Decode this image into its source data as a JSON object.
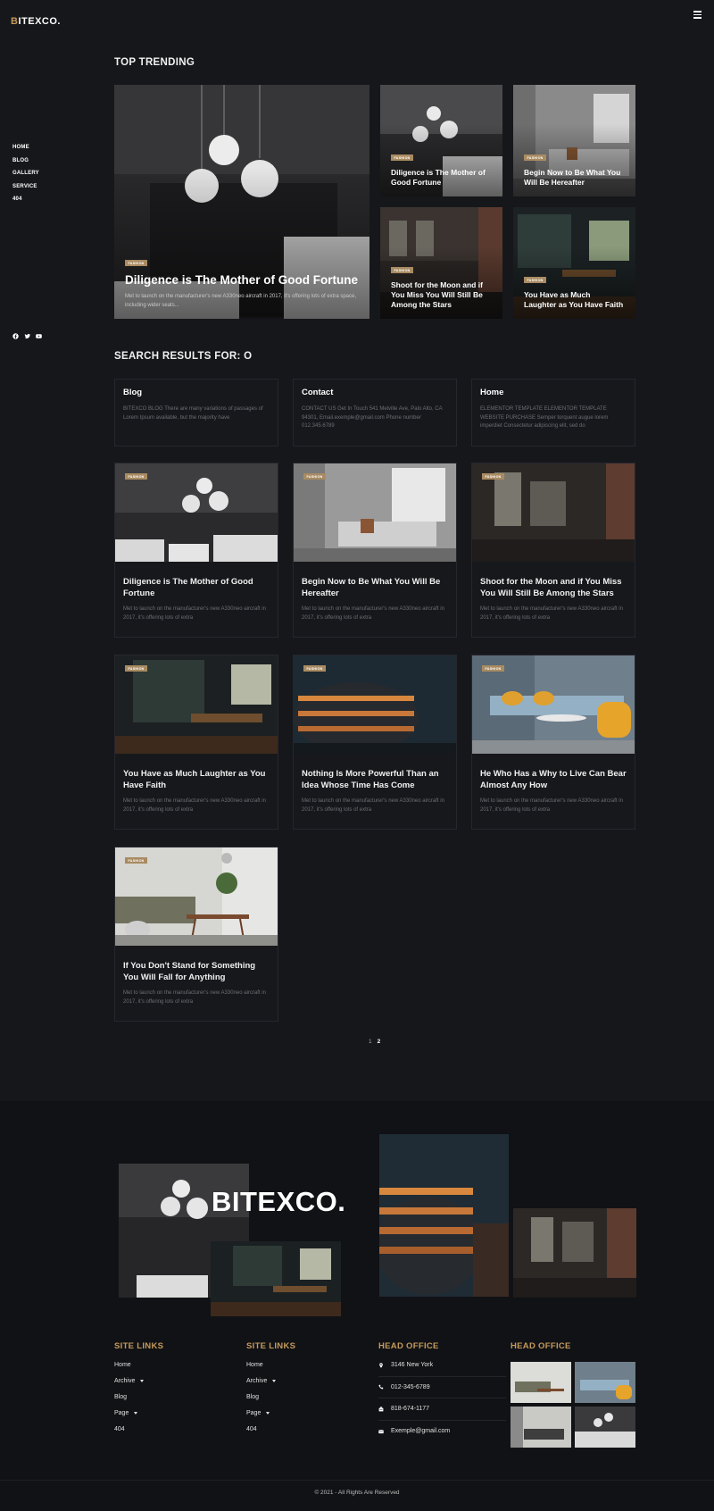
{
  "header": {
    "logo_first": "B",
    "logo_rest": "ITEXCO."
  },
  "nav": {
    "items": [
      "HOME",
      "BLOG",
      "GALLERY",
      "SERVICE",
      "404"
    ]
  },
  "social": [
    "facebook-icon",
    "twitter-icon",
    "youtube-icon"
  ],
  "trending": {
    "heading": "TOP TRENDING",
    "featured": {
      "badge": "FASHION",
      "title": "Diligence is The Mother of Good Fortune",
      "desc": "Met to launch on the manufacturer's new A330neo aircraft in 2017, it's offering lots of extra space, including wider seats..."
    },
    "cards": [
      {
        "badge": "FASHION",
        "title": "Diligence is The Mother of Good Fortune"
      },
      {
        "badge": "FASHION",
        "title": "Begin Now to Be What You Will Be Hereafter"
      },
      {
        "badge": "FASHION",
        "title": "Shoot for the Moon and if You Miss You Will Still Be Among the Stars"
      },
      {
        "badge": "FASHION",
        "title": "You Have as Much Laughter as You Have Faith"
      }
    ]
  },
  "search": {
    "heading": "SEARCH RESULTS FOR: O",
    "pages": [
      {
        "title": "Blog",
        "desc": "BITEXCO BLOG There are many variations of passages of Lorem Ipsum available, but the majority have"
      },
      {
        "title": "Contact",
        "desc": "CONTACT US Get In Touch 541 Melville Ave, Palo Alto, CA 94301, Email.exemple@gmail.com Phone number 012.345.6789"
      },
      {
        "title": "Home",
        "desc": "ELEMENTOR TEMPLATE ELEMENTOR TEMPLATE WEBSITE PURCHASE Semper torquent augue lorem imperdiet Consectetur adipiscing elit, sed do"
      }
    ],
    "posts": [
      {
        "badge": "FASHION",
        "title": "Diligence is The Mother of Good Fortune",
        "desc": "Met to launch on the manufacturer's new A330neo aircraft in 2017, it's offering lots of extra"
      },
      {
        "badge": "FASHION",
        "title": "Begin Now to Be What You Will Be Hereafter",
        "desc": "Met to launch on the manufacturer's new A330neo aircraft in 2017, it's offering lots of extra"
      },
      {
        "badge": "FASHION",
        "title": "Shoot for the Moon and if You Miss You Will Still Be Among the Stars",
        "desc": "Met to launch on the manufacturer's new A330neo aircraft in 2017, it's offering lots of extra"
      },
      {
        "badge": "FASHION",
        "title": "You Have as Much Laughter as You Have Faith",
        "desc": "Met to launch on the manufacturer's new A330neo aircraft in 2017, it's offering lots of extra"
      },
      {
        "badge": "FASHION",
        "title": "Nothing Is More Powerful Than an Idea Whose Time Has Come",
        "desc": "Met to launch on the manufacturer's new A330neo aircraft in 2017, it's offering lots of extra"
      },
      {
        "badge": "FASHION",
        "title": "He Who Has a Why to Live Can Bear Almost Any How",
        "desc": "Met to launch on the manufacturer's new A330neo aircraft in 2017, it's offering lots of extra"
      },
      {
        "badge": "FASHION",
        "title": "If You Don't Stand for Something You Will Fall for Anything",
        "desc": "Met to launch on the manufacturer's new A330neo aircraft in 2017, it's offering lots of extra"
      }
    ]
  },
  "pagination": {
    "current": "1",
    "next": "2"
  },
  "footer": {
    "brand": "BITEXCO.",
    "links1": {
      "heading": "SITE LINKS",
      "items": [
        "Home",
        "Archive",
        "Blog",
        "Page",
        "404"
      ]
    },
    "links2": {
      "heading": "SITE LINKS",
      "items": [
        "Home",
        "Archive",
        "Blog",
        "Page",
        "404"
      ]
    },
    "office": {
      "heading": "HEAD OFFICE",
      "address": "3146 New York",
      "phone1": "012-345-6789",
      "phone2": "818-674-1177",
      "email": "Exemple@gmail.com"
    },
    "gallery_heading": "HEAD OFFICE",
    "copyright": "© 2021 - All Rights Are Reserved"
  }
}
